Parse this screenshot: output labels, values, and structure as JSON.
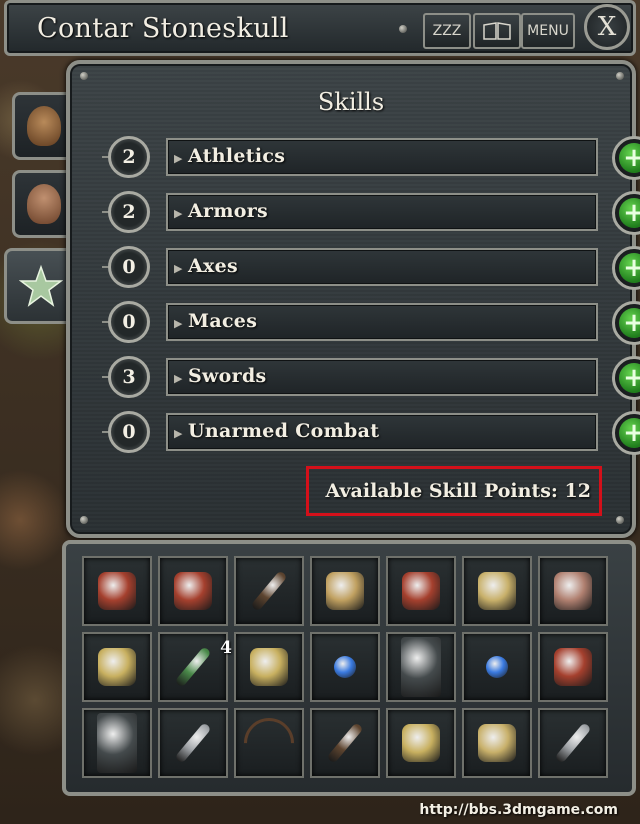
{
  "window": {
    "character_name": "Contar Stoneskull",
    "rest_label": "ZZZ",
    "journal_icon": "book-icon",
    "menu_label": "MENU",
    "close_label": "X"
  },
  "tabs": [
    {
      "name": "inventory-tab",
      "icon": "bag-icon",
      "active": false
    },
    {
      "name": "character-tab",
      "icon": "head-icon",
      "active": false
    },
    {
      "name": "skills-tab",
      "icon": "star-icon",
      "active": true
    }
  ],
  "skills_panel": {
    "title": "Skills",
    "skills": [
      {
        "value": "2",
        "label": "Athletics"
      },
      {
        "value": "2",
        "label": "Armors"
      },
      {
        "value": "0",
        "label": "Axes"
      },
      {
        "value": "0",
        "label": "Maces"
      },
      {
        "value": "3",
        "label": "Swords"
      },
      {
        "value": "0",
        "label": "Unarmed Combat"
      }
    ],
    "plus_symbol": "+",
    "available_points": "Available Skill Points: 12"
  },
  "inventory": {
    "slots": [
      {
        "icon": "armor-icon",
        "color": "#a5402e"
      },
      {
        "icon": "armor-icon",
        "color": "#a5402e"
      },
      {
        "icon": "club-icon",
        "color": "#5e4530"
      },
      {
        "icon": "belt-icon",
        "color": "#c0a060"
      },
      {
        "icon": "armor-icon",
        "color": "#a5402e"
      },
      {
        "icon": "hammer-icon",
        "color": "#c8b06a"
      },
      {
        "icon": "glove-icon",
        "color": "#b08070"
      },
      {
        "icon": "mushroom-icon",
        "color": "#c8b060"
      },
      {
        "icon": "feather-icon",
        "color": "#4a8a4a",
        "count": "4"
      },
      {
        "icon": "mushroom-icon",
        "color": "#c8b060"
      },
      {
        "icon": "orb-icon",
        "color": "#3a7ae0"
      },
      {
        "icon": "shield-icon",
        "color": "#444a4c"
      },
      {
        "icon": "orb-icon",
        "color": "#3a7ae0"
      },
      {
        "icon": "armor-icon",
        "color": "#a5402e"
      },
      {
        "icon": "shield-icon",
        "color": "#444a4c"
      },
      {
        "icon": "dagger-icon",
        "color": "#a0a4a8"
      },
      {
        "icon": "bow-icon",
        "color": "#5a3e2a"
      },
      {
        "icon": "club-icon",
        "color": "#5e4530"
      },
      {
        "icon": "mushroom-icon",
        "color": "#c8b060"
      },
      {
        "icon": "hammer-icon",
        "color": "#c8b06a"
      },
      {
        "icon": "dagger-icon",
        "color": "#a0a4a8"
      }
    ]
  },
  "watermark": "http://bbs.3dmgame.com"
}
